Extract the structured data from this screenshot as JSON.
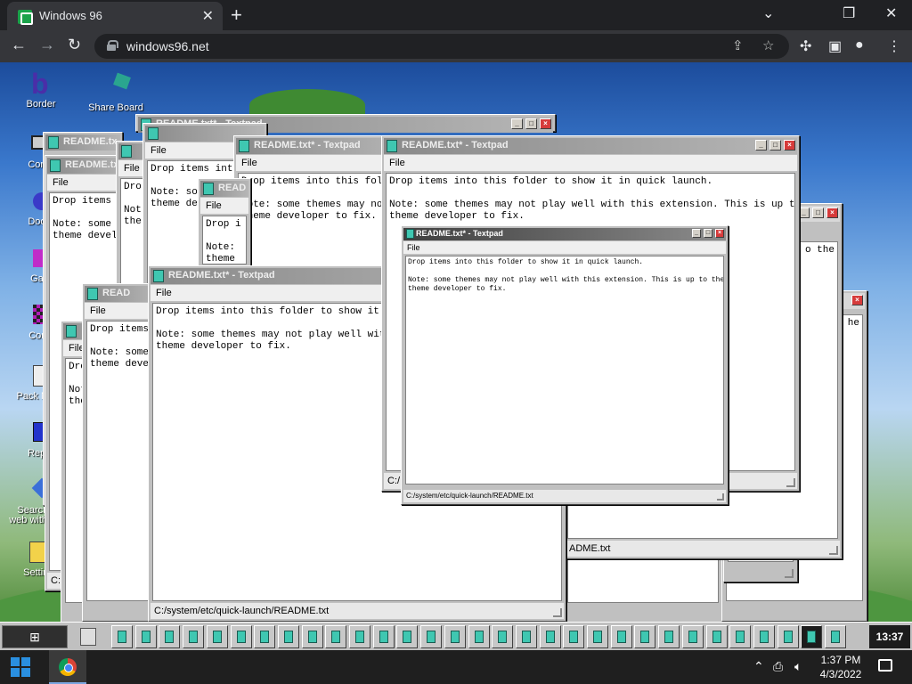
{
  "browser": {
    "tab_title": "Windows 96",
    "tab_close": "✕",
    "new_tab": "+",
    "url": "windows96.net",
    "controls": {
      "chevron": "⌄",
      "restore": "❐",
      "close": "✕"
    }
  },
  "desktop_icons": [
    {
      "label": "Border",
      "icon": "border-icon"
    },
    {
      "label": "Share Board",
      "icon": "share-board-icon"
    },
    {
      "label": "Comp",
      "icon": "computer-icon"
    },
    {
      "label": "Doom",
      "icon": "doom-icon"
    },
    {
      "label": "Gam",
      "icon": "games-icon"
    },
    {
      "label": "Corru",
      "icon": "corrupt-icon"
    },
    {
      "label": "Pack Mana",
      "icon": "package-manager-icon"
    },
    {
      "label": "Repor",
      "icon": "report-icon"
    },
    {
      "label": "Search the web with Bang",
      "icon": "search-web-icon"
    },
    {
      "label": "Settings",
      "icon": "settings-icon"
    }
  ],
  "textpad": {
    "title": "README.txt* - Textpad",
    "title_short": "README.tx",
    "title_trunc": "READ",
    "menu_file": "File",
    "line1": "Drop items into this folder to show it in quick launch.",
    "line2": "Note: some themes may not play well with this extension. This is up to the",
    "line3": "theme developer to fix.",
    "status": "C:/system/etc/quick-launch/README.txt",
    "status_partial": "ADME.txt",
    "frag_drop": "Drop items i",
    "frag_note": "Note: some t",
    "frag_devel": "theme develo",
    "frag_drop2": "Drop items into",
    "frag_note2": "Note: some",
    "frag_devel2": "theme dev",
    "frag_drop3": "Drop items into this folde",
    "frag_note3": "Note: some themes may not",
    "frag_devel3": "theme developer to fix.",
    "frag_drop4": "Drop items",
    "frag_note4": "Note: some",
    "frag_devel4": "theme devel",
    "frag_drop5": "Drop i",
    "frag_note5": "Note:",
    "frag_devel5": "theme",
    "frag_drop6": "Drop items into this folder to show it in",
    "frag_note6": "Note: some themes may not play well with t",
    "frag_the": "o the",
    "frag_he": "he",
    "frag_dro": "Dro",
    "frag_not": "Not",
    "frag_the2": "the",
    "frag_c": "C:/",
    "frag_drop7": "Drop items into this folder to show it in quick launch.",
    "frag_note7": "Note: some themes may not play well with this extension. This is up to the",
    "frag_devel7": "theme developer to fix."
  },
  "w96_taskbar": {
    "clock": "13:37",
    "task_count": 31
  },
  "win_taskbar": {
    "time": "1:37 PM",
    "date": "4/3/2022"
  }
}
